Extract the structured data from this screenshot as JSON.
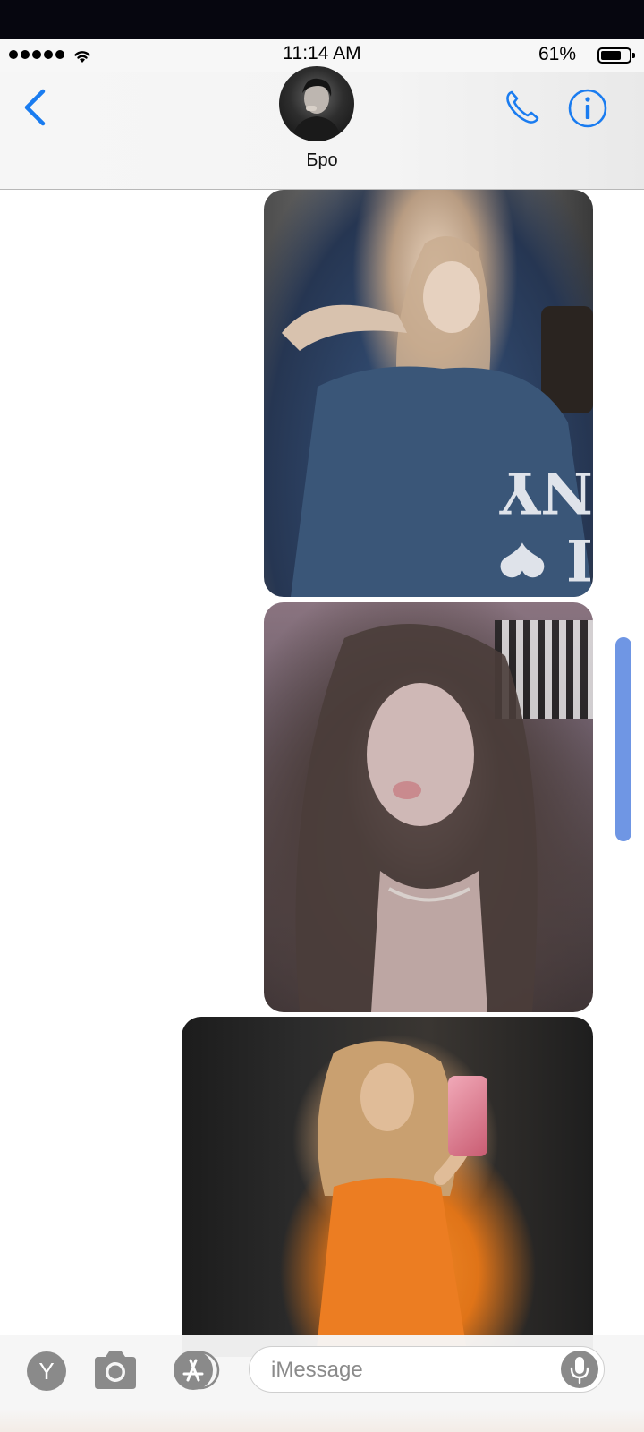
{
  "status_bar": {
    "time": "11:14 AM",
    "battery_percent": "61%",
    "battery_level": 0.61,
    "signal_bars": 5,
    "wifi_icon": "wifi-icon"
  },
  "nav": {
    "back_icon": "chevron-left-icon",
    "contact_name": "Бро",
    "call_icon": "phone-icon",
    "info_icon": "info-icon",
    "accent_color": "#1a7cf0"
  },
  "messages": [
    {
      "type": "image",
      "direction": "outgoing",
      "shirt_text": "I ❤ NY"
    },
    {
      "type": "image",
      "direction": "outgoing"
    },
    {
      "type": "image",
      "direction": "outgoing"
    }
  ],
  "input_bar": {
    "app_button_label": "Y",
    "camera_icon": "camera-icon",
    "appstore_icon": "appstore-icon",
    "placeholder": "iMessage",
    "mic_icon": "microphone-icon"
  }
}
